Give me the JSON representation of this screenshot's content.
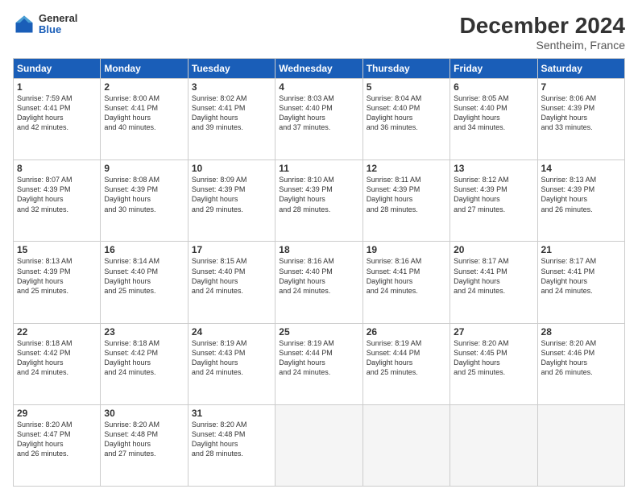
{
  "logo": {
    "general": "General",
    "blue": "Blue"
  },
  "header": {
    "title": "December 2024",
    "subtitle": "Sentheim, France"
  },
  "calendar": {
    "days": [
      "Sunday",
      "Monday",
      "Tuesday",
      "Wednesday",
      "Thursday",
      "Friday",
      "Saturday"
    ],
    "cells": [
      {
        "day": 1,
        "sunrise": "7:59 AM",
        "sunset": "4:41 PM",
        "daylight": "8 hours and 42 minutes."
      },
      {
        "day": 2,
        "sunrise": "8:00 AM",
        "sunset": "4:41 PM",
        "daylight": "8 hours and 40 minutes."
      },
      {
        "day": 3,
        "sunrise": "8:02 AM",
        "sunset": "4:41 PM",
        "daylight": "8 hours and 39 minutes."
      },
      {
        "day": 4,
        "sunrise": "8:03 AM",
        "sunset": "4:40 PM",
        "daylight": "8 hours and 37 minutes."
      },
      {
        "day": 5,
        "sunrise": "8:04 AM",
        "sunset": "4:40 PM",
        "daylight": "8 hours and 36 minutes."
      },
      {
        "day": 6,
        "sunrise": "8:05 AM",
        "sunset": "4:40 PM",
        "daylight": "8 hours and 34 minutes."
      },
      {
        "day": 7,
        "sunrise": "8:06 AM",
        "sunset": "4:39 PM",
        "daylight": "8 hours and 33 minutes."
      },
      {
        "day": 8,
        "sunrise": "8:07 AM",
        "sunset": "4:39 PM",
        "daylight": "8 hours and 32 minutes."
      },
      {
        "day": 9,
        "sunrise": "8:08 AM",
        "sunset": "4:39 PM",
        "daylight": "8 hours and 30 minutes."
      },
      {
        "day": 10,
        "sunrise": "8:09 AM",
        "sunset": "4:39 PM",
        "daylight": "8 hours and 29 minutes."
      },
      {
        "day": 11,
        "sunrise": "8:10 AM",
        "sunset": "4:39 PM",
        "daylight": "8 hours and 28 minutes."
      },
      {
        "day": 12,
        "sunrise": "8:11 AM",
        "sunset": "4:39 PM",
        "daylight": "8 hours and 28 minutes."
      },
      {
        "day": 13,
        "sunrise": "8:12 AM",
        "sunset": "4:39 PM",
        "daylight": "8 hours and 27 minutes."
      },
      {
        "day": 14,
        "sunrise": "8:13 AM",
        "sunset": "4:39 PM",
        "daylight": "8 hours and 26 minutes."
      },
      {
        "day": 15,
        "sunrise": "8:13 AM",
        "sunset": "4:39 PM",
        "daylight": "8 hours and 25 minutes."
      },
      {
        "day": 16,
        "sunrise": "8:14 AM",
        "sunset": "4:40 PM",
        "daylight": "8 hours and 25 minutes."
      },
      {
        "day": 17,
        "sunrise": "8:15 AM",
        "sunset": "4:40 PM",
        "daylight": "8 hours and 24 minutes."
      },
      {
        "day": 18,
        "sunrise": "8:16 AM",
        "sunset": "4:40 PM",
        "daylight": "8 hours and 24 minutes."
      },
      {
        "day": 19,
        "sunrise": "8:16 AM",
        "sunset": "4:41 PM",
        "daylight": "8 hours and 24 minutes."
      },
      {
        "day": 20,
        "sunrise": "8:17 AM",
        "sunset": "4:41 PM",
        "daylight": "8 hours and 24 minutes."
      },
      {
        "day": 21,
        "sunrise": "8:17 AM",
        "sunset": "4:41 PM",
        "daylight": "8 hours and 24 minutes."
      },
      {
        "day": 22,
        "sunrise": "8:18 AM",
        "sunset": "4:42 PM",
        "daylight": "8 hours and 24 minutes."
      },
      {
        "day": 23,
        "sunrise": "8:18 AM",
        "sunset": "4:42 PM",
        "daylight": "8 hours and 24 minutes."
      },
      {
        "day": 24,
        "sunrise": "8:19 AM",
        "sunset": "4:43 PM",
        "daylight": "8 hours and 24 minutes."
      },
      {
        "day": 25,
        "sunrise": "8:19 AM",
        "sunset": "4:44 PM",
        "daylight": "8 hours and 24 minutes."
      },
      {
        "day": 26,
        "sunrise": "8:19 AM",
        "sunset": "4:44 PM",
        "daylight": "8 hours and 25 minutes."
      },
      {
        "day": 27,
        "sunrise": "8:20 AM",
        "sunset": "4:45 PM",
        "daylight": "8 hours and 25 minutes."
      },
      {
        "day": 28,
        "sunrise": "8:20 AM",
        "sunset": "4:46 PM",
        "daylight": "8 hours and 26 minutes."
      },
      {
        "day": 29,
        "sunrise": "8:20 AM",
        "sunset": "4:47 PM",
        "daylight": "8 hours and 26 minutes."
      },
      {
        "day": 30,
        "sunrise": "8:20 AM",
        "sunset": "4:48 PM",
        "daylight": "8 hours and 27 minutes."
      },
      {
        "day": 31,
        "sunrise": "8:20 AM",
        "sunset": "4:48 PM",
        "daylight": "8 hours and 28 minutes."
      }
    ]
  }
}
